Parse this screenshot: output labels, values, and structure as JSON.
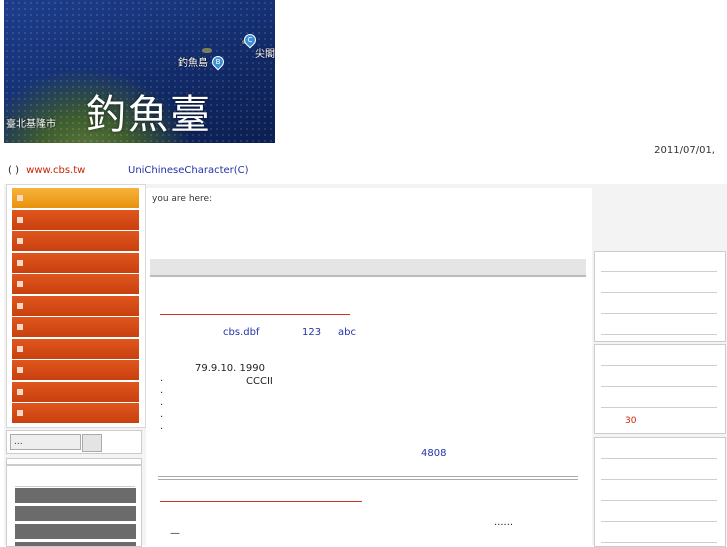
{
  "banner": {
    "title": "釣魚臺",
    "place_left": "釣魚島",
    "place_right": "尖閣",
    "place_bottom": "臺北基隆市",
    "pin_b": "B",
    "pin_c": "C"
  },
  "header": {
    "date": "2011/07/01,",
    "paren": "( )",
    "site_link": "www.cbs.tw",
    "unichar_link": "UniChineseCharacter(C)"
  },
  "breadcrumb": {
    "label": "you are here:"
  },
  "leftnav": {
    "items": [
      "",
      "",
      "",
      "",
      "",
      "",
      "",
      "",
      "",
      ""
    ]
  },
  "search": {
    "value": "..."
  },
  "main": {
    "link1": "cbs.dbf",
    "link2": "123",
    "link3": "abc",
    "date_line": "79.9.10. 1990",
    "cccii": "CCCII",
    "bullets": [
      "·",
      "·",
      "·",
      "·",
      "·",
      "·"
    ],
    "count": "4808",
    "ellipsis": "......",
    "dash": "—"
  },
  "right": {
    "number": "30"
  }
}
